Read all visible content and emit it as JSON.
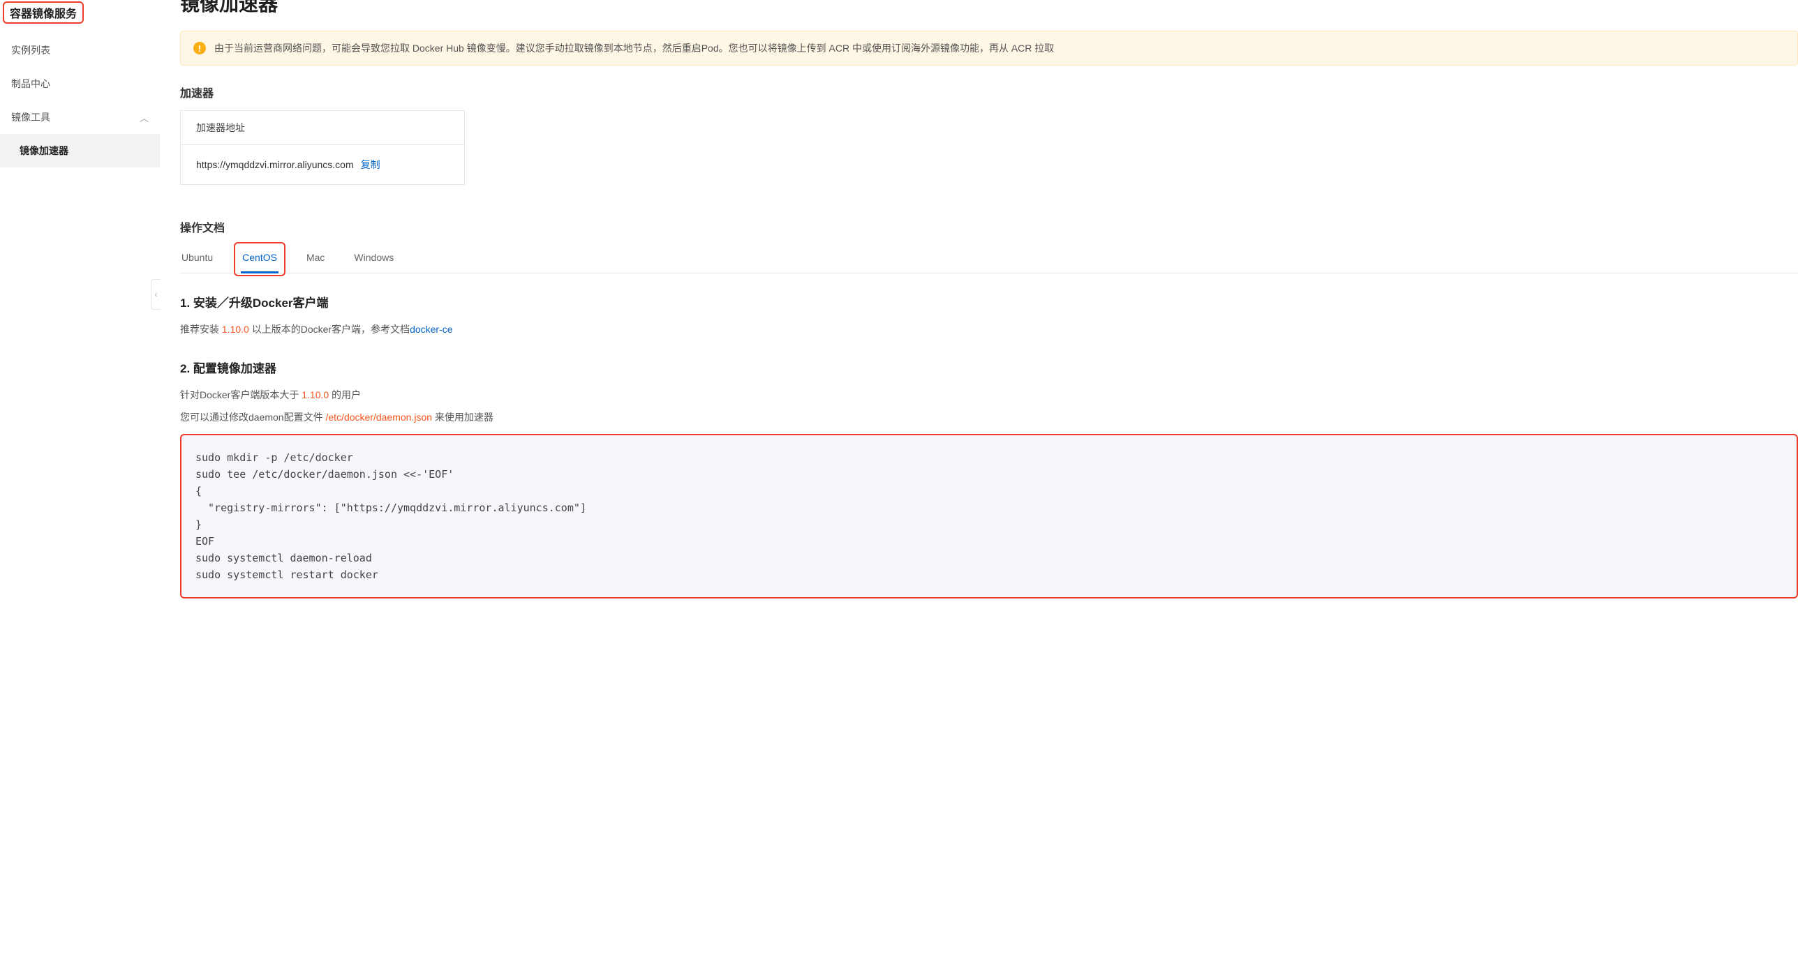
{
  "sidebar": {
    "title": "容器镜像服务",
    "items": [
      {
        "label": "实例列表",
        "expandable": false
      },
      {
        "label": "制品中心",
        "expandable": false
      },
      {
        "label": "镜像工具",
        "expandable": true
      },
      {
        "label": "镜像加速器",
        "expandable": false,
        "active": true,
        "sub": true
      }
    ]
  },
  "main": {
    "page_title": "镜像加速器",
    "alert": {
      "text": "由于当前运营商网络问题，可能会导致您拉取 Docker Hub 镜像变慢。建议您手动拉取镜像到本地节点，然后重启Pod。您也可以将镜像上传到 ACR 中或使用订阅海外源镜像功能，再从 ACR 拉取"
    },
    "accelerator": {
      "title": "加速器",
      "addr_label": "加速器地址",
      "addr_value": "https://ymqddzvi.mirror.aliyuncs.com",
      "copy": "复制"
    },
    "docs": {
      "title": "操作文档",
      "tabs": [
        "Ubuntu",
        "CentOS",
        "Mac",
        "Windows"
      ],
      "active_tab": "CentOS",
      "section1_title": "1. 安装／升级Docker客户端",
      "section1_text_pre": "推荐安装 ",
      "section1_version": "1.10.0",
      "section1_text_mid": " 以上版本的Docker客户端，参考文档",
      "section1_link": "docker-ce",
      "section2_title": "2. 配置镜像加速器",
      "section2_p1_pre": "针对Docker客户端版本大于 ",
      "section2_p1_ver": "1.10.0",
      "section2_p1_suf": " 的用户",
      "section2_p2_pre": "您可以通过修改daemon配置文件 ",
      "section2_p2_path": "/etc/docker/daemon.json",
      "section2_p2_suf": " 来使用加速器",
      "code": "sudo mkdir -p /etc/docker\nsudo tee /etc/docker/daemon.json <<-'EOF'\n{\n  \"registry-mirrors\": [\"https://ymqddzvi.mirror.aliyuncs.com\"]\n}\nEOF\nsudo systemctl daemon-reload\nsudo systemctl restart docker"
    }
  }
}
